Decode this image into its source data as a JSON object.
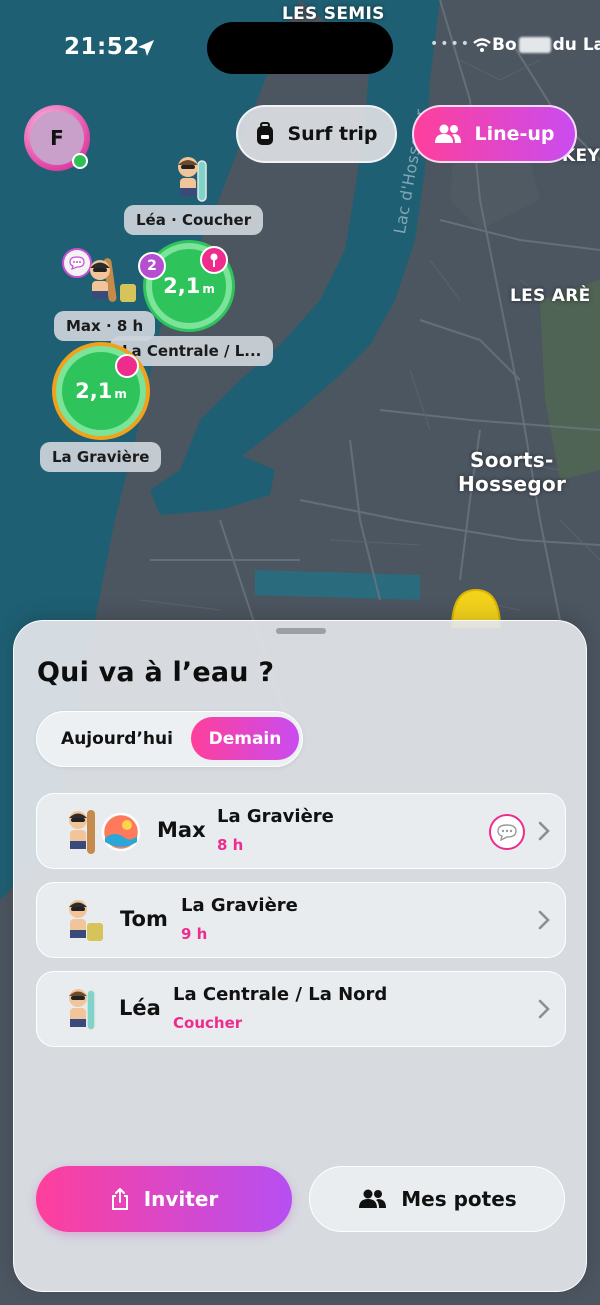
{
  "status_bar": {
    "time": "21:52",
    "carrier_prefix": "Bo",
    "carrier_suffix": "du La",
    "icons": [
      "location-arrow-icon",
      "wifi-icon"
    ]
  },
  "map": {
    "labels": {
      "les_semis": "LES SEMIS",
      "key": "KEY",
      "les_arenes": "LES ARÈ",
      "lake": "Lac d'Hossegor",
      "town_line1": "Soorts-",
      "town_line2": "Hossegor"
    },
    "markers": {
      "lea_tag": "Léa · Coucher",
      "max_tag": "Max · 8 h",
      "centrale_tag": "La Centrale / L...",
      "graviere_tag": "La Gravière",
      "spot1": {
        "value": "2,1",
        "unit": "m",
        "badge": "2"
      },
      "spot2": {
        "value": "2,1",
        "unit": "m"
      }
    },
    "colors": {
      "water": "#1f5f73",
      "land": "#4c5660",
      "spot_green": "#2ec45b",
      "spot_ring_orange": "#f0a21a"
    }
  },
  "top": {
    "avatar_initial": "F",
    "surf_trip_label": "Surf trip",
    "lineup_label": "Line-up"
  },
  "sheet": {
    "title": "Qui va à l’eau ?",
    "tabs": {
      "today": "Aujourd’hui",
      "tomorrow": "Demain",
      "selected": "Demain"
    },
    "rows": [
      {
        "name": "Max",
        "spot": "La Gravière",
        "time": "8 h",
        "has_message": true
      },
      {
        "name": "Tom",
        "spot": "La Gravière",
        "time": "9 h",
        "has_message": false
      },
      {
        "name": "Léa",
        "spot": "La Centrale / La Nord",
        "time": "Coucher",
        "has_message": false
      }
    ],
    "invite_label": "Inviter",
    "friends_label": "Mes potes",
    "accent": "#ee2c8e"
  }
}
